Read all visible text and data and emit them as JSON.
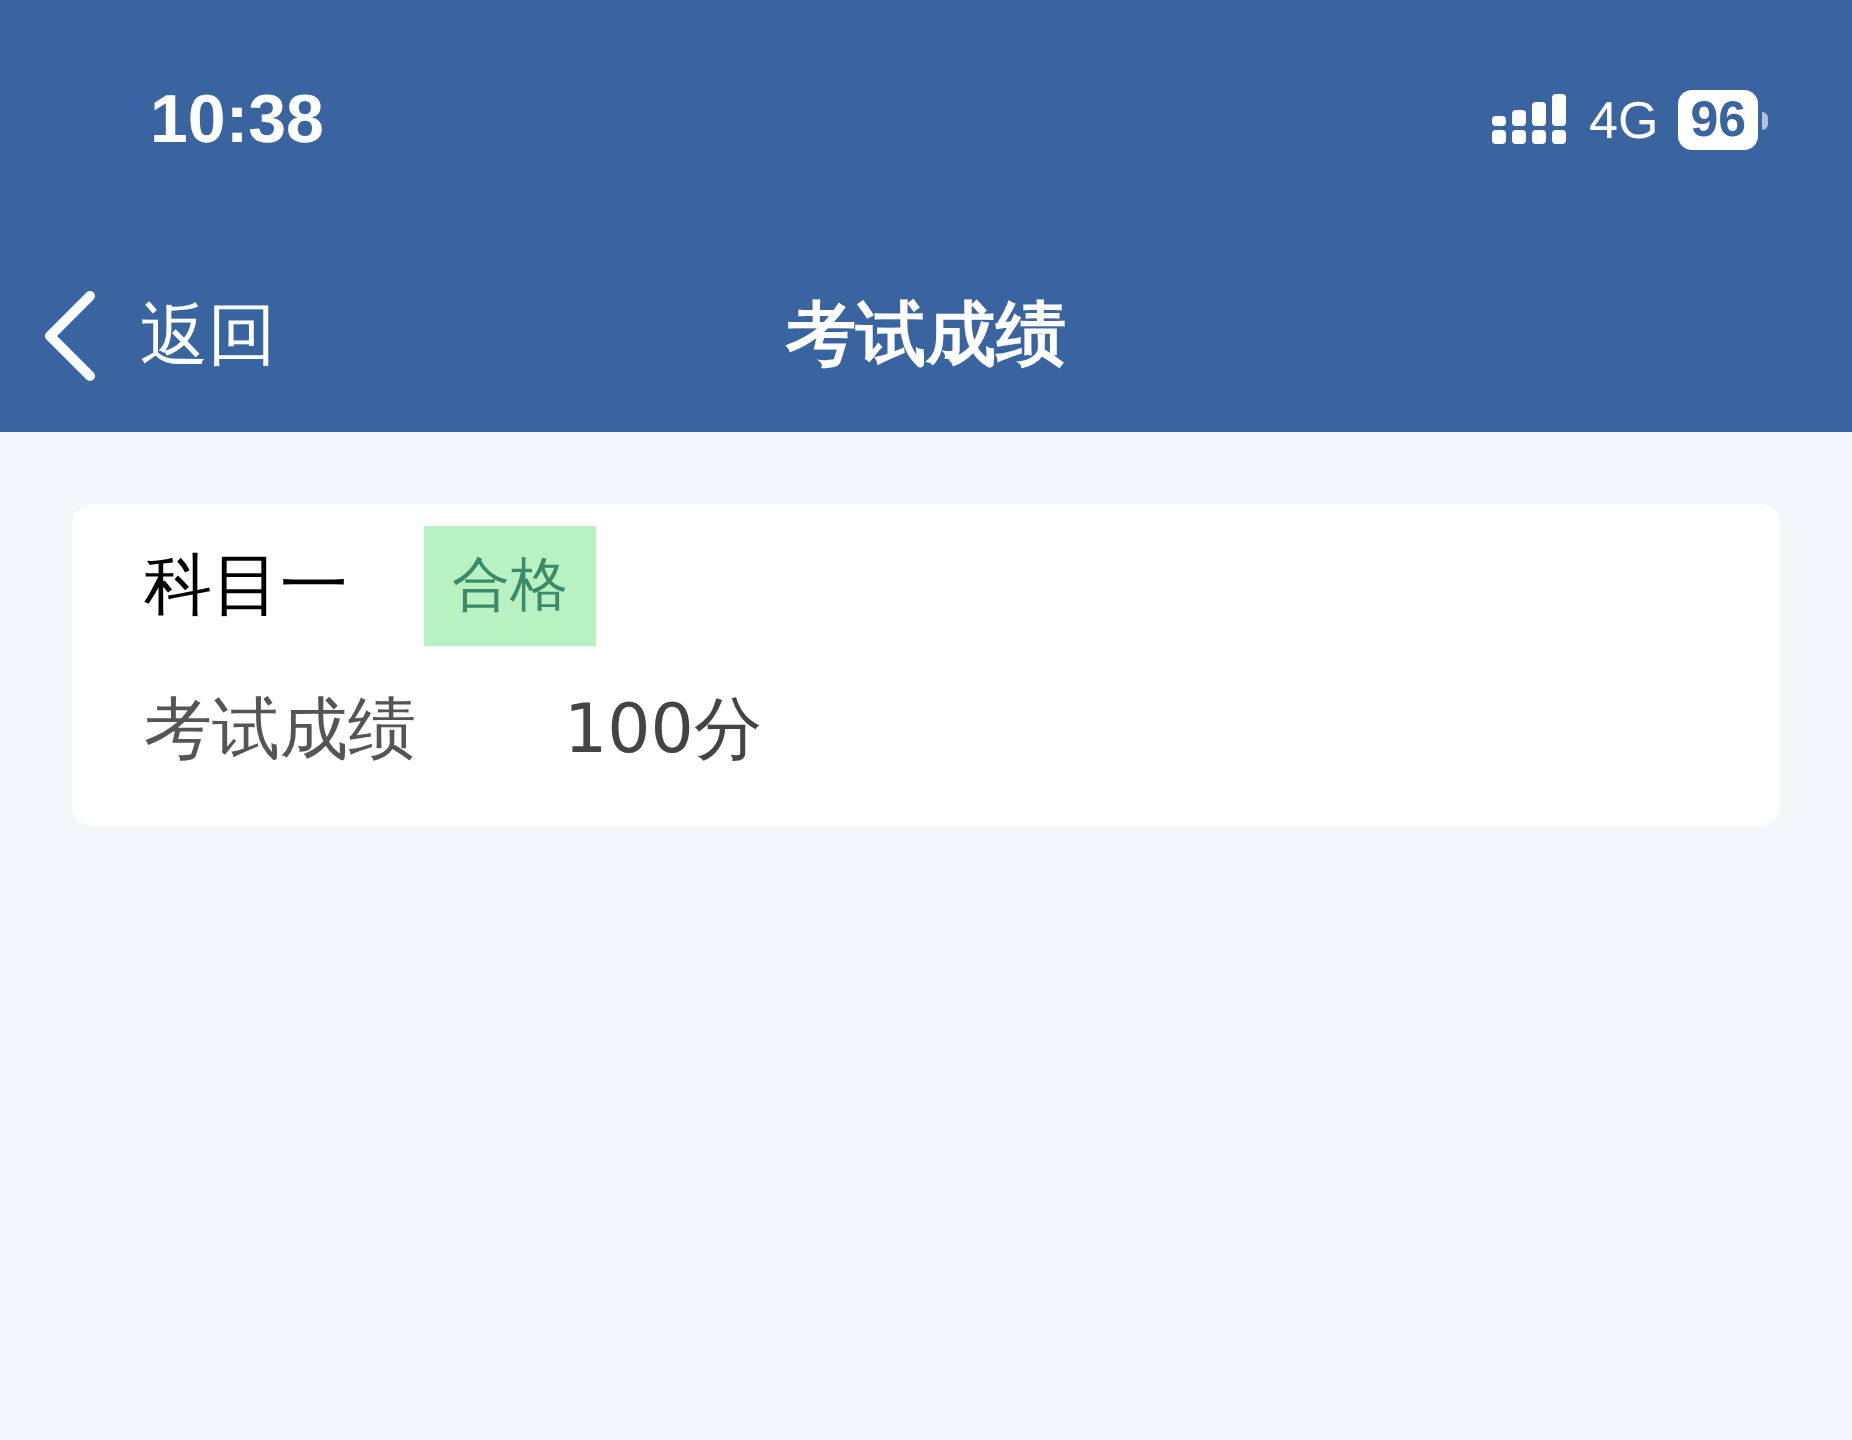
{
  "status_bar": {
    "time": "10:38",
    "network": "4G",
    "battery": "96"
  },
  "nav": {
    "back": "返回",
    "title": "考试成绩"
  },
  "results": [
    {
      "subject": "科目一",
      "badge": "合格",
      "passed": true,
      "score_label": "考试成绩",
      "score": "100分"
    }
  ]
}
